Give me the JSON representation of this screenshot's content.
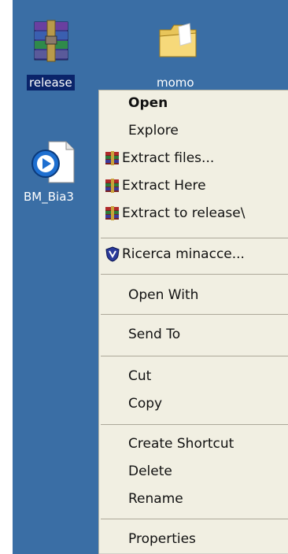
{
  "desktop": {
    "icons": [
      {
        "label": "release",
        "type": "winrar-archive-icon",
        "selected": true
      },
      {
        "label": "momo",
        "type": "folder-icon"
      },
      {
        "label": "BM_Bia3",
        "type": "media-player-file-icon"
      }
    ]
  },
  "context_menu": {
    "items": {
      "open": "Open",
      "explore": "Explore",
      "extract_files": "Extract files...",
      "extract_here": "Extract Here",
      "extract_to": "Extract to release\\",
      "scan": "Ricerca minacce...",
      "open_with": "Open With",
      "send_to": "Send To",
      "cut": "Cut",
      "copy": "Copy",
      "create_shortcut": "Create Shortcut",
      "delete": "Delete",
      "rename": "Rename",
      "properties": "Properties"
    }
  },
  "colors": {
    "desktop_bg": "#3a6ea5",
    "menu_bg": "#f1efe2",
    "selection": "#0a246a"
  }
}
